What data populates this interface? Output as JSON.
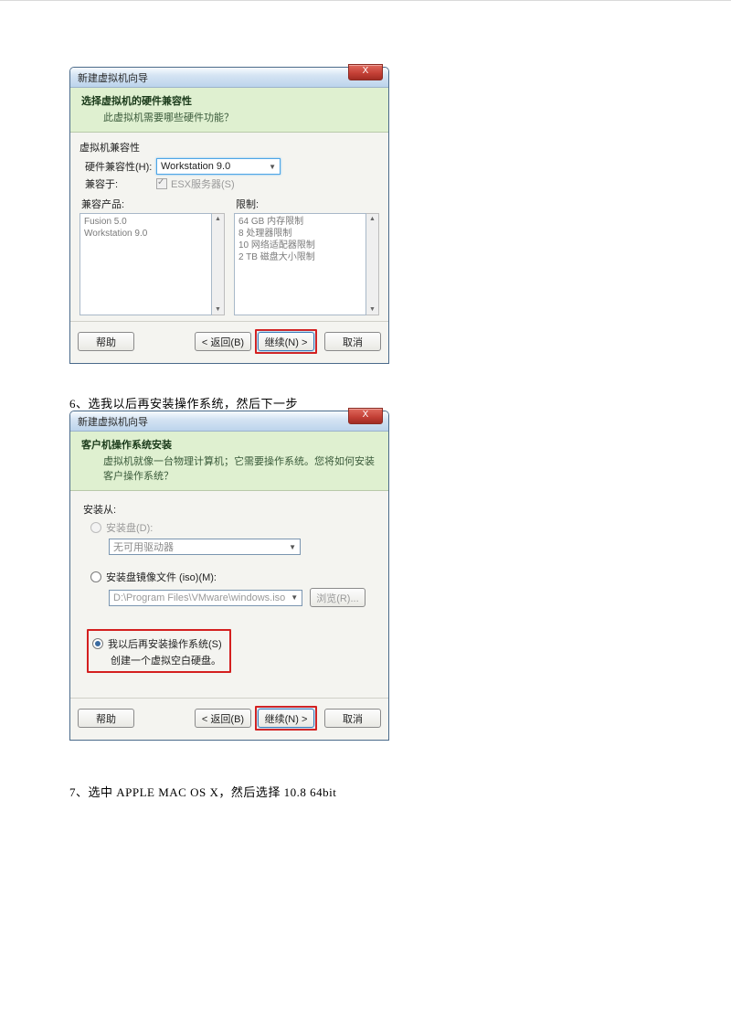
{
  "dialog1": {
    "title": "新建虚拟机向导",
    "close": "X",
    "header_title": "选择虚拟机的硬件兼容性",
    "header_sub": "此虚拟机需要哪些硬件功能？",
    "group_label": "虚拟机兼容性",
    "hw_label": "硬件兼容性(H):",
    "hw_value": "Workstation 9.0",
    "compat_label": "兼容于:",
    "esx_label": "ESX服务器(S)",
    "col_products": "兼容产品:",
    "col_limits": "限制:",
    "products": [
      "Fusion 5.0",
      "Workstation 9.0"
    ],
    "limits": [
      "64 GB 内存限制",
      "8 处理器限制",
      "10 网络适配器限制",
      "2 TB 磁盘大小限制"
    ],
    "help": "帮助",
    "back": "< 返回(B)",
    "next": "继续(N) >",
    "cancel": "取消"
  },
  "caption1": "6、选我以后再安装操作系统，然后下一步",
  "dialog2": {
    "title": "新建虚拟机向导",
    "close": "X",
    "header_title": "客户机操作系统安装",
    "header_sub": "虚拟机就像一台物理计算机；它需要操作系统。您将如何安装客户操作系统？",
    "install_from": "安装从:",
    "opt_disc": "安装盘(D):",
    "drive_value": "无可用驱动器",
    "opt_iso": "安装盘镜像文件 (iso)(M):",
    "iso_path": "D:\\Program Files\\VMware\\windows.iso",
    "browse": "浏览(R)...",
    "opt_later": "我以后再安装操作系统(S)",
    "later_sub": "创建一个虚拟空白硬盘。",
    "help": "帮助",
    "back": "< 返回(B)",
    "next": "继续(N) >",
    "cancel": "取消"
  },
  "caption2": "7、选中 APPLE  MAC  OS  X，然后选择 10.8  64bit"
}
